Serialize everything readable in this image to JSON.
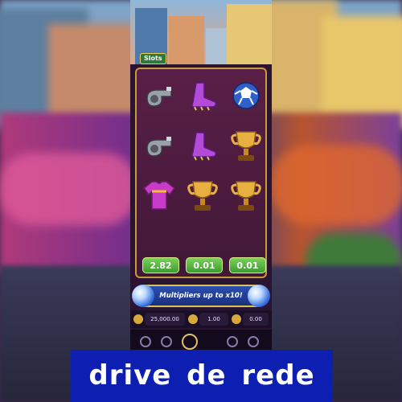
{
  "game": {
    "logo_text": "Slots",
    "symbols": [
      [
        "whistle-icon",
        "boot-icon",
        "ball-icon"
      ],
      [
        "whistle-icon",
        "boot-icon",
        "trophy-icon"
      ],
      [
        "jersey-icon",
        "trophy-icon",
        "trophy-icon"
      ]
    ],
    "wins": [
      "2.82",
      "0.01",
      "0.01"
    ],
    "banner_text": "Multipliers up to x10!",
    "balance": "25,000.00",
    "bet": "1.00",
    "win_field": "0.00"
  },
  "caption": {
    "text": "drive de rede"
  },
  "colors": {
    "caption_bg": "#0c1fb0",
    "win_badge": "#4fb03a",
    "frame_gold": "#c99a3a",
    "banner_blue": "#2b4fb3"
  }
}
